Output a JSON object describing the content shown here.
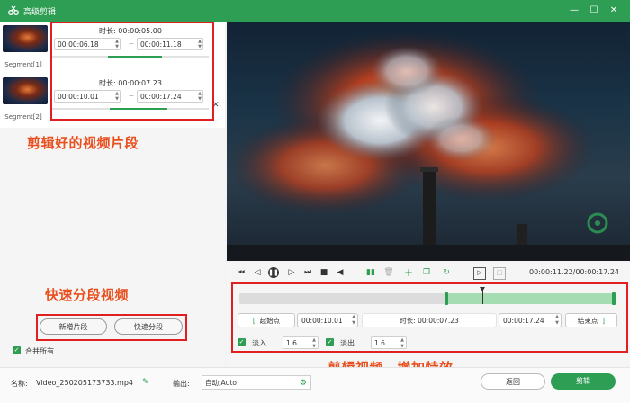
{
  "window": {
    "title": "高级剪辑"
  },
  "segments": [
    {
      "label": "Segment[1]",
      "duration_label": "时长:",
      "duration": "00:00:05.00",
      "start": "00:00:06.18",
      "end": "00:00:11.18"
    },
    {
      "label": "Segment[2]",
      "duration_label": "时长:",
      "duration": "00:00:07.23",
      "start": "00:00:10.01",
      "end": "00:00:17.24"
    }
  ],
  "annotations": {
    "segments": "剪辑好的视频片段",
    "quick": "快速分段视频",
    "edit": "剪辑视频、增加特效"
  },
  "left_buttons": {
    "new_segment": "新增片段",
    "quick_split": "快速分段"
  },
  "merge_all": {
    "label": "合并所有",
    "checked": true
  },
  "player": {
    "time_readout": "00:00:11.22/00:00:17.24"
  },
  "edit": {
    "start_btn": "起始点",
    "start_value": "00:00:10.01",
    "duration_label": "时长:",
    "duration_value": "00:00:07.23",
    "end_value": "00:00:17.24",
    "end_btn": "结束点",
    "fade_in_label": "淡入",
    "fade_in_value": "1.6",
    "fade_out_label": "淡出",
    "fade_out_value": "1.6",
    "selection_start": 0.55,
    "selection_end": 1.0,
    "playhead": 0.645
  },
  "footer": {
    "name_label": "名称:",
    "name_value": "Video_250205173733.mp4",
    "output_label": "输出:",
    "output_value": "自动;Auto",
    "back_btn": "返回",
    "cut_btn": "剪辑"
  },
  "colors": {
    "accent": "#2e9e54",
    "annotation": "#e8501f",
    "highlight_box": "#e02020"
  },
  "icons": [
    "app-logo-icon",
    "minimize-icon",
    "maximize-icon",
    "close-icon",
    "pencil-icon",
    "gear-icon"
  ]
}
